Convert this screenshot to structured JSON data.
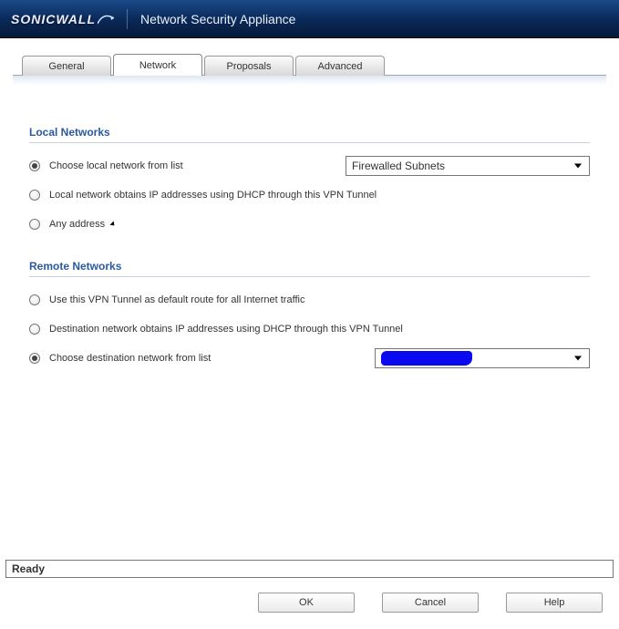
{
  "header": {
    "brand": "SONICWALL",
    "title": "Network Security Appliance"
  },
  "tabs": {
    "items": [
      {
        "label": "General"
      },
      {
        "label": "Network"
      },
      {
        "label": "Proposals"
      },
      {
        "label": "Advanced"
      }
    ],
    "active_index": 1
  },
  "sections": {
    "local": {
      "title": "Local Networks",
      "options": [
        {
          "label": "Choose local network from list",
          "checked": true
        },
        {
          "label": "Local network obtains IP addresses using DHCP through this VPN Tunnel",
          "checked": false
        },
        {
          "label": "Any address",
          "checked": false
        }
      ],
      "dropdown": {
        "value": "Firewalled Subnets"
      }
    },
    "remote": {
      "title": "Remote Networks",
      "options": [
        {
          "label": "Use this VPN Tunnel as default route for all Internet traffic",
          "checked": false
        },
        {
          "label": "Destination network obtains IP addresses using DHCP through this VPN Tunnel",
          "checked": false
        },
        {
          "label": "Choose destination network from list",
          "checked": true
        }
      ],
      "dropdown": {
        "value": ""
      }
    }
  },
  "status": {
    "text": "Ready"
  },
  "buttons": {
    "ok": "OK",
    "cancel": "Cancel",
    "help": "Help"
  }
}
